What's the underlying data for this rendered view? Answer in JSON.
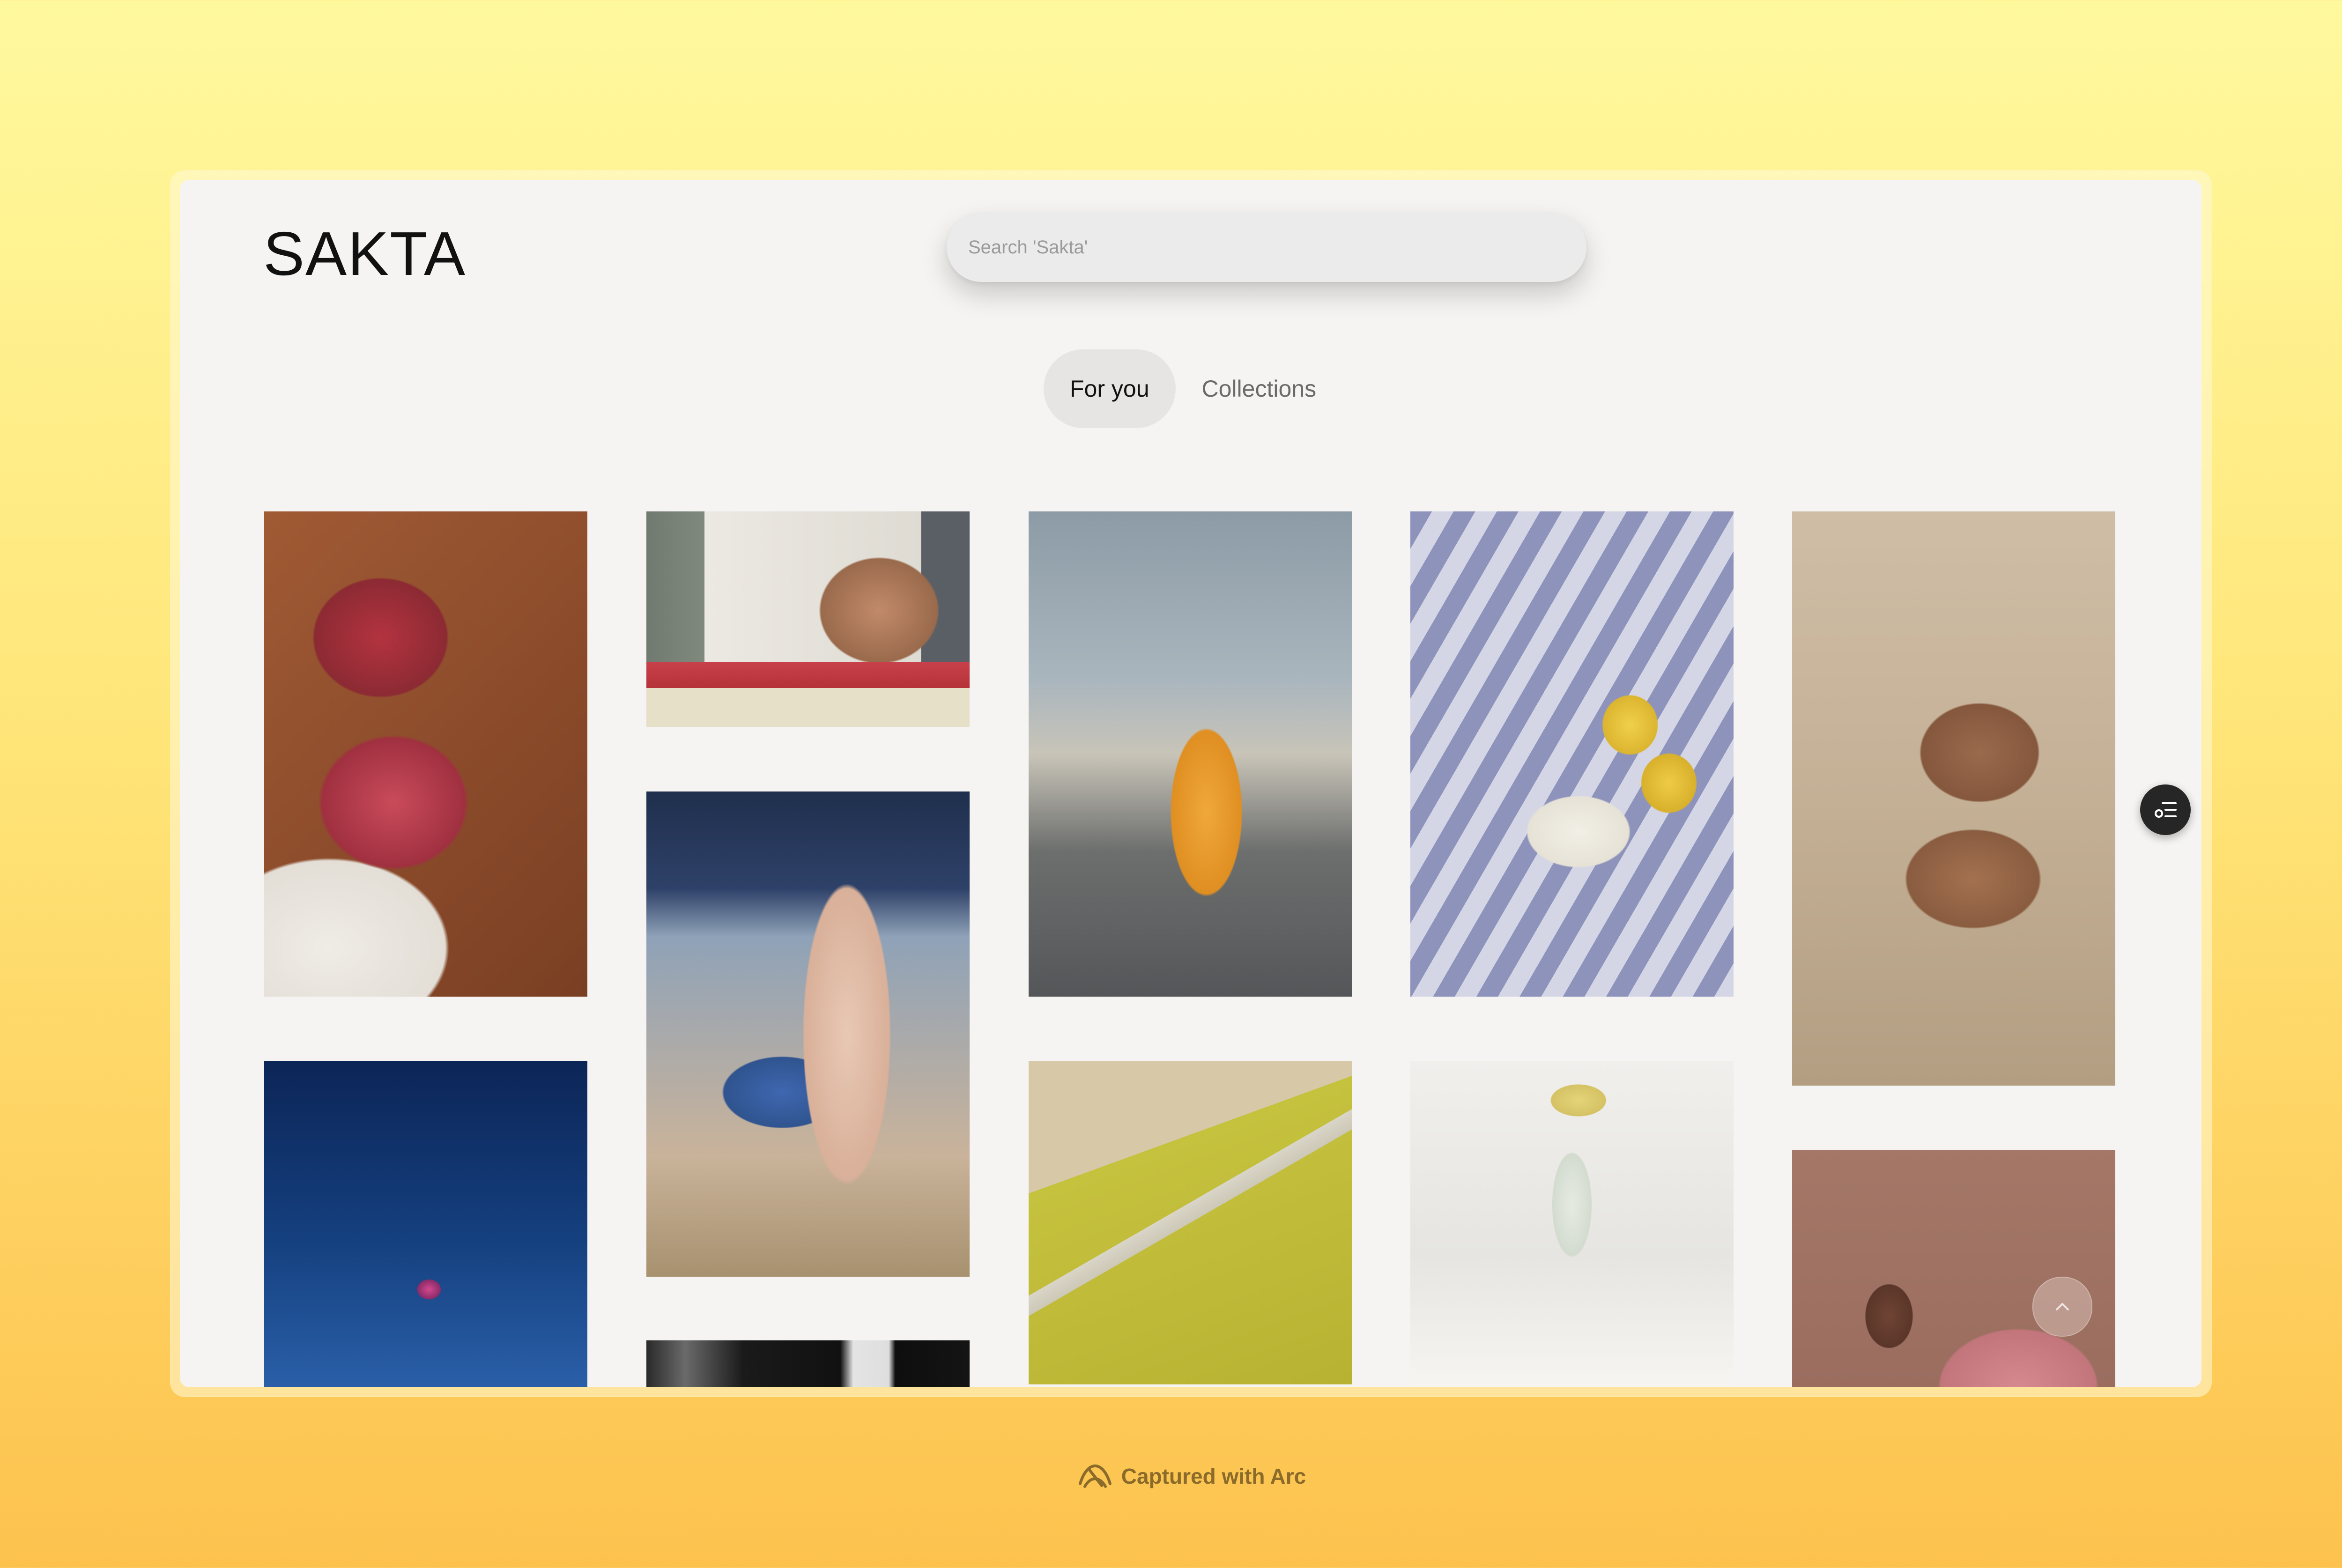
{
  "app": {
    "logo": "SAKTA",
    "search_placeholder": "Search 'Sakta'"
  },
  "tabs": [
    {
      "label": "For you",
      "active": true
    },
    {
      "label": "Collections",
      "active": false
    }
  ],
  "photos": [
    {
      "name": "pomegranate-drink-photo",
      "colors": [
        "#8a4a2c",
        "#c23a44",
        "#e9e4de"
      ]
    },
    {
      "name": "ice-cream-truck-photo",
      "colors": [
        "#6f7870",
        "#dddad2",
        "#b83a3a"
      ]
    },
    {
      "name": "tram-street-photo",
      "colors": [
        "#9aa6ae",
        "#e59a2e",
        "#5f6468"
      ]
    },
    {
      "name": "lemons-picnic-photo",
      "colors": [
        "#8d93b8",
        "#e5c24a",
        "#c9cbe0"
      ]
    },
    {
      "name": "hands-bracelets-photo",
      "colors": [
        "#cdbba4",
        "#8f5e44",
        "#b79f84"
      ]
    },
    {
      "name": "blue-sky-kite-photo",
      "colors": [
        "#0d2a5c",
        "#1a4a8f",
        "#2a5fa8"
      ]
    },
    {
      "name": "feet-sandals-water-photo",
      "colors": [
        "#253d66",
        "#c9b39a",
        "#3f67b0"
      ]
    },
    {
      "name": "yellow-field-road-photo",
      "colors": [
        "#b9b33a",
        "#d4c7a0",
        "#8c8a30"
      ]
    },
    {
      "name": "flowers-coffee-photo",
      "colors": [
        "#e8e6e2",
        "#f3f1ee",
        "#d9cf9a"
      ]
    },
    {
      "name": "pink-sweater-photo",
      "colors": [
        "#a7786a",
        "#d68a8f",
        "#8f5e54"
      ]
    },
    {
      "name": "black-white-strip-photo",
      "colors": [
        "#1a1a1a",
        "#8a8a8a",
        "#e4e4e4"
      ]
    }
  ],
  "footer": {
    "text": "Captured with Arc",
    "icon": "arc-icon"
  }
}
